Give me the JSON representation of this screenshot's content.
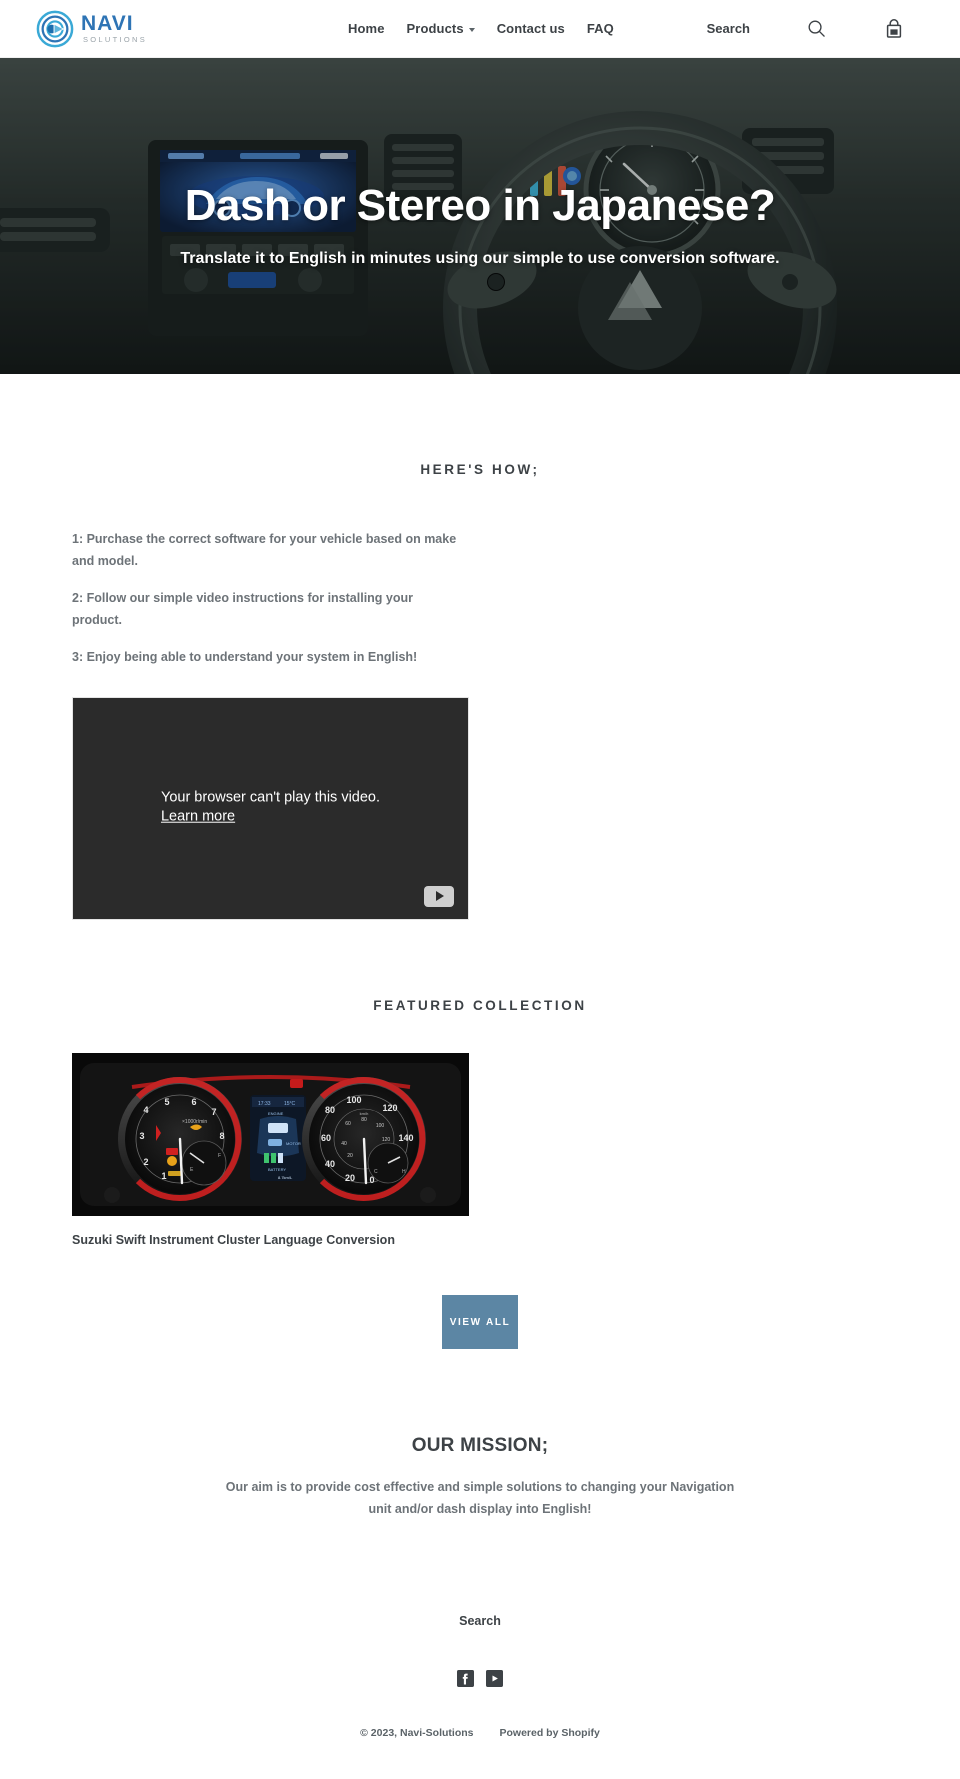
{
  "header": {
    "logo": {
      "name": "NAVI",
      "subtitle": "SOLUTIONS",
      "icon": "navi-target-play-logo",
      "color": "#2e74b5"
    },
    "nav": [
      {
        "label": "Home",
        "has_dropdown": false
      },
      {
        "label": "Products",
        "has_dropdown": true
      },
      {
        "label": "Contact us",
        "has_dropdown": false
      },
      {
        "label": "FAQ",
        "has_dropdown": false
      }
    ],
    "search_label": "Search",
    "search_icon": "search-icon",
    "cart_icon": "shopping-bag-icon"
  },
  "hero": {
    "title": "Dash or Stereo in Japanese?",
    "subtitle": "Translate it to English in minutes using our simple to use conversion software.",
    "background": "car-dashboard-steering-wheel-photo"
  },
  "howto": {
    "title": "HERE'S HOW;",
    "steps": [
      "1: Purchase the correct software for your vehicle based on make and model.",
      "2: Follow our simple video instructions for installing your product.",
      "3: Enjoy being able to understand your system in English!"
    ],
    "video": {
      "error_message": "Your browser can't play this video.",
      "learn_more": "Learn more",
      "play_icon": "youtube-play-icon"
    }
  },
  "featured": {
    "title": "FEATURED COLLECTION",
    "products": [
      {
        "title": "Suzuki Swift Instrument Cluster Language Conversion",
        "image": "suzuki-swift-instrument-cluster-photo"
      }
    ],
    "view_all_label": "VIEW ALL",
    "view_all_line1": "VIEW",
    "view_all_line2": "ALL",
    "view_all_color": "#5c86a4"
  },
  "mission": {
    "title": "OUR MISSION;",
    "body": "Our aim is to provide cost effective and simple solutions to changing your Navigation unit and/or dash display into English!"
  },
  "footer": {
    "search_label": "Search",
    "social": [
      {
        "name": "facebook-icon",
        "label": "Facebook"
      },
      {
        "name": "youtube-icon",
        "label": "YouTube"
      }
    ],
    "copyright": "© 2023, Navi-Solutions",
    "powered_by": "Powered by Shopify"
  }
}
